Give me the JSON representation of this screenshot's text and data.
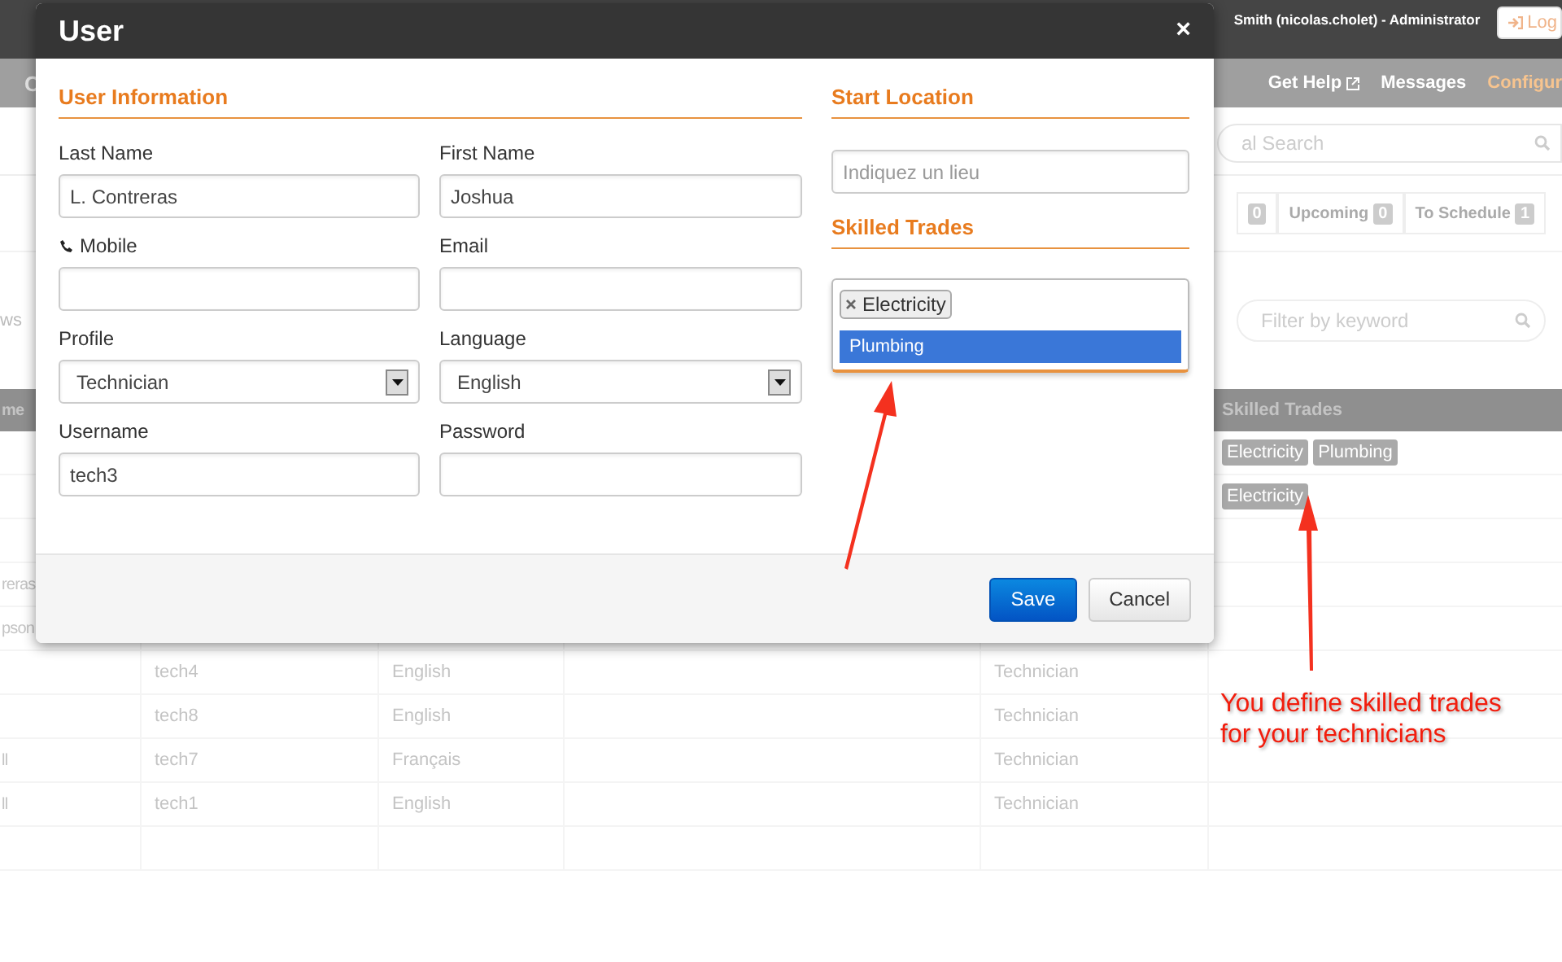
{
  "top_bar": {
    "user": "Smith (nicolas.cholet) - Administrator",
    "logout": "Log"
  },
  "nav": {
    "brand": "C",
    "items": [
      {
        "label": "Get Help",
        "external": true,
        "selected": false
      },
      {
        "label": "Messages",
        "external": false,
        "selected": false
      },
      {
        "label": "Configur",
        "external": false,
        "selected": true
      }
    ]
  },
  "search": {
    "placeholder": "al Search"
  },
  "tabs": [
    {
      "count": "0"
    },
    {
      "label": "Upcoming",
      "count": "0"
    },
    {
      "label": "To Schedule",
      "count": "1"
    }
  ],
  "views_label": "ws",
  "filter": {
    "placeholder": "Filter by keyword"
  },
  "table": {
    "header": {
      "column_1": "me",
      "skilled_trades": "Skilled Trades"
    },
    "rows": [
      {
        "skilled_trades": [
          "Electricity",
          "Plumbing"
        ]
      },
      {
        "skilled_trades": [
          "Electricity"
        ]
      },
      {},
      {
        "column_1": "reras"
      },
      {
        "column_1": "pson"
      },
      {
        "column_2": "tech4",
        "column_3": "English",
        "column_5": "Technician"
      },
      {
        "column_2": "tech8",
        "column_3": "English",
        "column_5": "Technician"
      },
      {
        "column_1": "ll",
        "column_2": "tech7",
        "column_3": "Français",
        "column_5": "Technician"
      },
      {
        "column_1": "ll",
        "column_2": "tech1",
        "column_3": "English",
        "column_5": "Technician"
      },
      {}
    ]
  },
  "dialog": {
    "title": "User",
    "close": "×",
    "user_information": {
      "heading": "User Information",
      "fields": [
        {
          "label": "Last Name",
          "kind": "text",
          "value": "L. Contreras"
        },
        {
          "label": "First Name",
          "kind": "text",
          "value": "Joshua"
        },
        {
          "label": "Mobile",
          "kind": "phone"
        },
        {
          "label": "Email",
          "kind": "text"
        },
        {
          "label": "Profile",
          "kind": "select",
          "value": "Technician"
        },
        {
          "label": "Language",
          "kind": "select",
          "value": "English"
        },
        {
          "label": "Username",
          "kind": "text",
          "value": "tech3"
        },
        {
          "label": "Password",
          "kind": "password"
        }
      ]
    },
    "start_location": {
      "heading": "Start Location",
      "placeholder": "Indiquez un lieu"
    },
    "skilled_trades": {
      "heading": "Skilled Trades",
      "chosen": [
        "Electricity"
      ],
      "options": [
        {
          "label": "Plumbing",
          "selected": true
        }
      ]
    },
    "buttons": [
      {
        "label": "Save",
        "kind": "primary"
      },
      {
        "label": "Cancel",
        "kind": "default"
      }
    ]
  },
  "annotation": {
    "text": "You define skilled trades for your technicians"
  }
}
